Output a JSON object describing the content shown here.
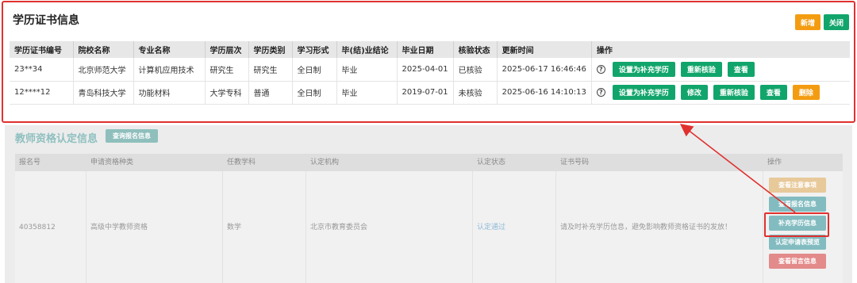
{
  "edu": {
    "title": "学历证书信息",
    "add_label": "新增",
    "close_label": "关闭",
    "columns": [
      "学历证书编号",
      "院校名称",
      "专业名称",
      "学历层次",
      "学历类别",
      "学习形式",
      "毕(结)业结论",
      "毕业日期",
      "核验状态",
      "更新时间",
      "操作"
    ],
    "rows": [
      {
        "cert_no": "23**34",
        "school": "北京师范大学",
        "major": "计算机应用技术",
        "level": "研究生",
        "category": "研究生",
        "form": "全日制",
        "conclusion": "毕业",
        "grad_date": "2025-04-01",
        "status": "已核验",
        "updated": "2025-06-17 16:46:46",
        "buttons": [
          "设置为补充学历",
          "重新核验",
          "查看"
        ]
      },
      {
        "cert_no": "12****12",
        "school": "青岛科技大学",
        "major": "功能材料",
        "level": "大学专科",
        "category": "普通",
        "form": "全日制",
        "conclusion": "毕业",
        "grad_date": "2019-07-01",
        "status": "未核验",
        "updated": "2025-06-16 14:10:13",
        "buttons": [
          "设置为补充学历",
          "修改",
          "重新核验",
          "查看",
          "删除"
        ]
      }
    ]
  },
  "teacher": {
    "title": "教师资格认定信息",
    "query_label": "查询报名信息",
    "columns": [
      "报名号",
      "申请资格种类",
      "任教学科",
      "认定机构",
      "认定状态",
      "证书号码",
      "操作"
    ],
    "row": {
      "reg_no": "40358812",
      "kind": "高级中学教师资格",
      "subject": "数学",
      "agency": "北京市教育委员会",
      "status": "认定通过",
      "cert_note": "请及时补充学历信息，避免影响教师资格证书的发放！"
    },
    "ops": [
      "查看注意事项",
      "查看报名信息",
      "补充学历信息",
      "认定申请表预览",
      "查看留言信息"
    ]
  },
  "colors": {
    "highlight": "#e0312f",
    "green": "#12a56b",
    "orange": "#f39c12"
  }
}
